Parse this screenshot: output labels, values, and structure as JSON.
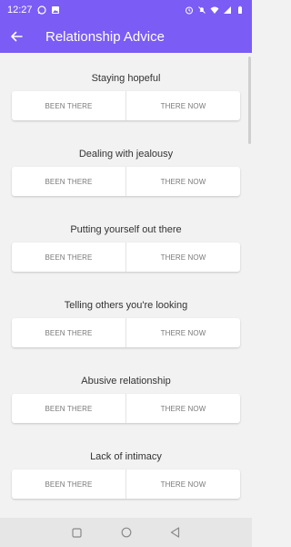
{
  "status": {
    "time": "12:27",
    "battery_icon": "battery-icon"
  },
  "header": {
    "title": "Relationship Advice"
  },
  "sections": [
    {
      "title": "Staying hopeful",
      "left": "BEEN THERE",
      "right": "THERE NOW"
    },
    {
      "title": "Dealing with jealousy",
      "left": "BEEN THERE",
      "right": "THERE NOW"
    },
    {
      "title": "Putting yourself out there",
      "left": "BEEN THERE",
      "right": "THERE NOW"
    },
    {
      "title": "Telling others you're looking",
      "left": "BEEN THERE",
      "right": "THERE NOW"
    },
    {
      "title": "Abusive relationship",
      "left": "BEEN THERE",
      "right": "THERE NOW"
    },
    {
      "title": "Lack of intimacy",
      "left": "BEEN THERE",
      "right": "THERE NOW"
    }
  ],
  "colors": {
    "accent": "#7b5cf5"
  }
}
